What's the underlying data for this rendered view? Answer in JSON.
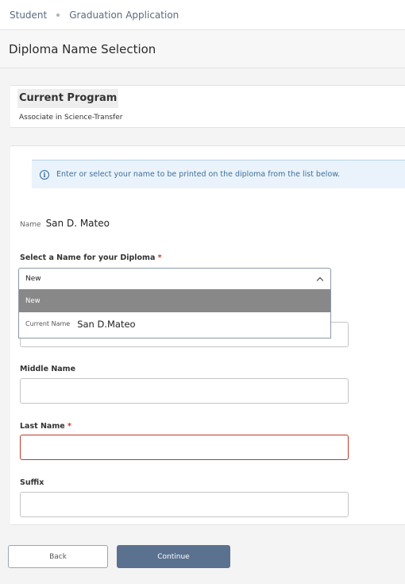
{
  "breadcrumb": {
    "items": [
      "Student",
      "Graduation Application"
    ]
  },
  "page_title": "Diploma Name Selection",
  "current_program": {
    "heading": "Current Program",
    "value": "Associate in Science-Transfer"
  },
  "info_banner": {
    "icon": "info-icon",
    "text": "Enter or select your name to be printed on the diploma from the list below."
  },
  "name_display": {
    "label": "Name",
    "value": "San D. Mateo"
  },
  "diploma_select": {
    "label": "Select a Name for your Diploma",
    "required_mark": "*",
    "selected_value": "New",
    "options": [
      {
        "label": "New"
      },
      {
        "prefix": "Current Name",
        "label": "San D.Mateo"
      }
    ]
  },
  "fields": {
    "middle_name": {
      "label": "Middle Name",
      "value": ""
    },
    "last_name": {
      "label": "Last Name",
      "required_mark": "*",
      "value": ""
    },
    "suffix": {
      "label": "Suffix",
      "value": ""
    }
  },
  "buttons": {
    "back": "Back",
    "continue": "Continue"
  },
  "colors": {
    "primary_button": "#5b7190",
    "required": "#c0392b",
    "info_text": "#3f6f9e",
    "info_background": "#eaf3fb",
    "selected_option": "#888888"
  }
}
